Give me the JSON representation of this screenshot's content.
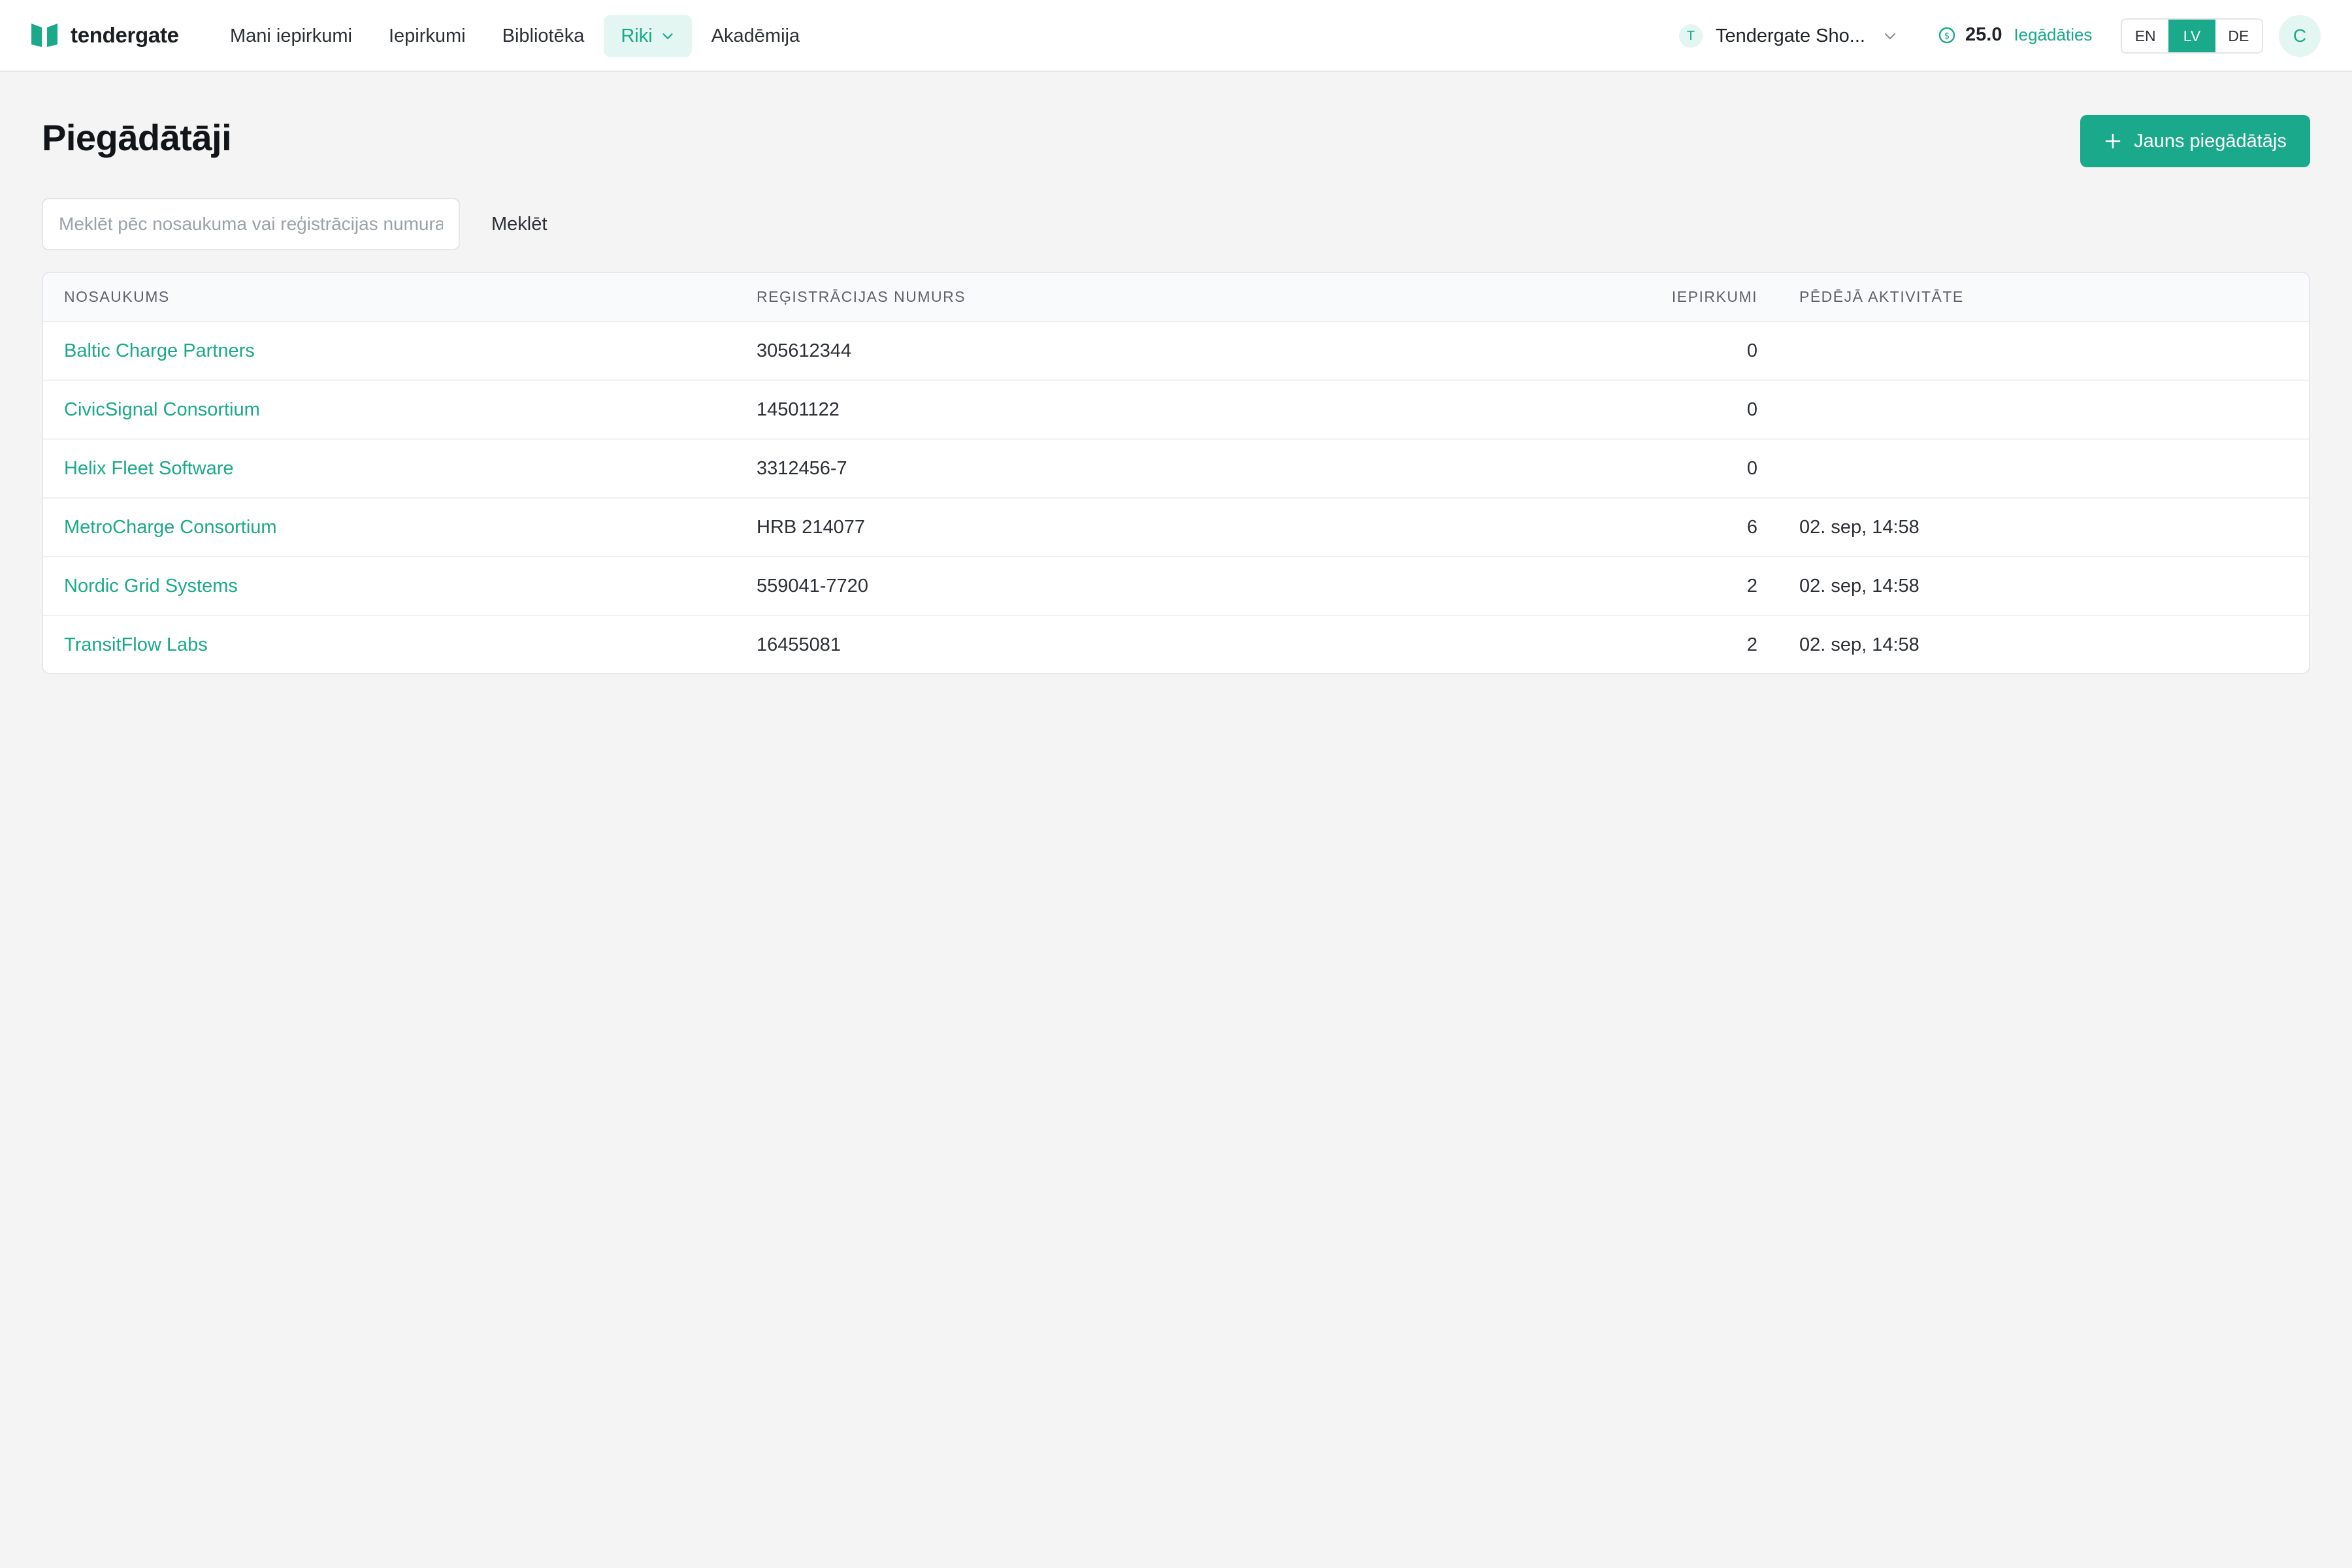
{
  "app": {
    "logo_text": "tendergate",
    "brand_color": "#1aa98a"
  },
  "nav": {
    "items": [
      {
        "label": "Mani iepirkumi"
      },
      {
        "label": "Iepirkumi"
      },
      {
        "label": "Bibliotēka"
      },
      {
        "label": "Riki",
        "active": true,
        "icon": "chevron-down-icon"
      },
      {
        "label": "Akadēmija"
      }
    ]
  },
  "org": {
    "badge": "T",
    "name": "Tendergate Sho...",
    "icon": "chevron-down-icon"
  },
  "credits": {
    "icon": "coin-icon",
    "value": "25.0",
    "link": "Iegādāties"
  },
  "languages": {
    "options": [
      "EN",
      "LV",
      "DE"
    ],
    "selected": "LV"
  },
  "user": {
    "avatar_initial": "C"
  },
  "page": {
    "title": "Piegādātāji",
    "new_button": "Jauns piegādātājs",
    "new_button_icon": "plus-icon"
  },
  "search": {
    "placeholder": "Meklēt pēc nosaukuma vai reģistrācijas numura",
    "value": "",
    "button": "Meklēt"
  },
  "table": {
    "columns": [
      "NOSAUKUMS",
      "REĢISTRĀCIJAS NUMURS",
      "IEPIRKUMI",
      "PĒDĒJĀ AKTIVITĀTE"
    ],
    "rows": [
      {
        "name": "Baltic Charge Partners",
        "reg": "305612344",
        "count": "0",
        "activity": ""
      },
      {
        "name": "CivicSignal Consortium",
        "reg": "14501122",
        "count": "0",
        "activity": ""
      },
      {
        "name": "Helix Fleet Software",
        "reg": "3312456-7",
        "count": "0",
        "activity": ""
      },
      {
        "name": "MetroCharge Consortium",
        "reg": "HRB 214077",
        "count": "6",
        "activity": "02. sep, 14:58"
      },
      {
        "name": "Nordic Grid Systems",
        "reg": "559041-7720",
        "count": "2",
        "activity": "02. sep, 14:58"
      },
      {
        "name": "TransitFlow Labs",
        "reg": "16455081",
        "count": "2",
        "activity": "02. sep, 14:58"
      }
    ]
  }
}
